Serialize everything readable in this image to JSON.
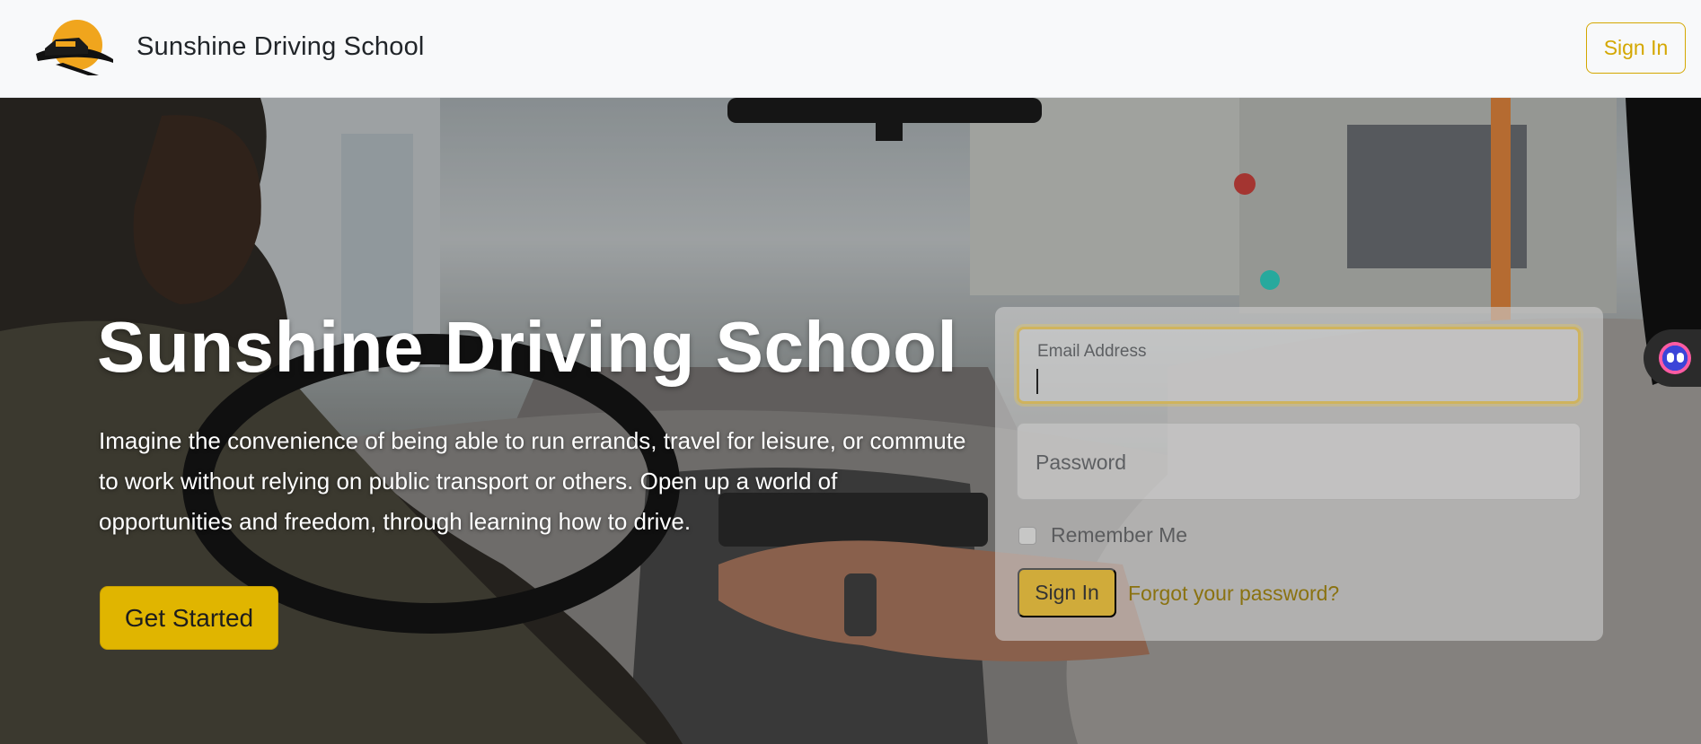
{
  "navbar": {
    "brand_name": "Sunshine Driving School",
    "logo_icon": "car-on-road-sun-logo",
    "signin_label": "Sign In"
  },
  "hero": {
    "title": "Sunshine Driving School",
    "description": "Imagine the convenience of being able to run errands, travel for leisure, or commute to work without relying on public transport or others. Open up a world of opportunities and freedom, through learning how to drive.",
    "cta_label": "Get Started",
    "background": "photo-driving-lesson-interior"
  },
  "login_form": {
    "email_label": "Email Address",
    "email_value": "",
    "password_label": "Password",
    "password_value": "",
    "remember_label": "Remember Me",
    "remember_checked": false,
    "submit_label": "Sign In",
    "forgot_label": "Forgot your password?"
  },
  "side_widget": {
    "icon": "assistant-face-icon"
  },
  "colors": {
    "accent": "#e0b500",
    "accent_outline": "#d4a700",
    "navbar_bg": "#f8f9fa",
    "brand_text": "#212529"
  }
}
